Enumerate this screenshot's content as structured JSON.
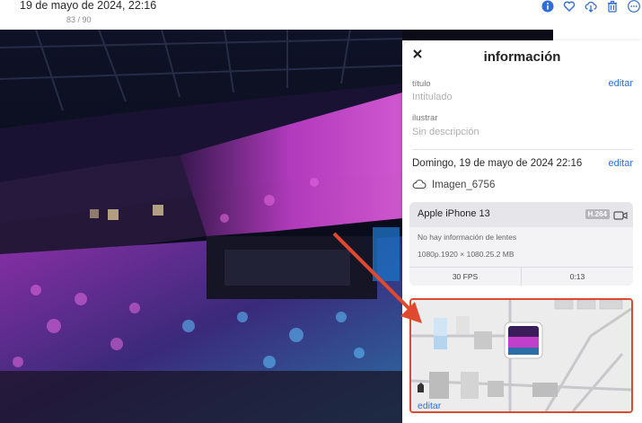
{
  "header": {
    "title": "19 de mayo de 2024, 22:16",
    "counter": "83 / 90"
  },
  "toolbar": {
    "icons": [
      "info-icon",
      "heart-icon",
      "cloud-download-icon",
      "trash-icon",
      "more-icon"
    ]
  },
  "panel": {
    "heading": "información",
    "title_label": "título",
    "title_placeholder": "Intitulado",
    "edit_label": "editar",
    "description_label": "ilustrar",
    "description_placeholder": "Sin descripción",
    "date_text": "Domingo, 19 de mayo de 2024 22:16",
    "filename": "Imagen_6756",
    "device": {
      "name": "Apple iPhone 13",
      "codec": "H.264",
      "lens": "No hay información de lentes",
      "specs": "1080p.1920 × 1080.25.2 MB",
      "fps": "30 FPS",
      "duration": "0:13"
    },
    "map_edit": "editar"
  },
  "colors": {
    "accent": "#2f6fd6",
    "highlight": "#e0492f",
    "photo_pink": "#d64ad8",
    "photo_blue": "#46a6e6"
  }
}
